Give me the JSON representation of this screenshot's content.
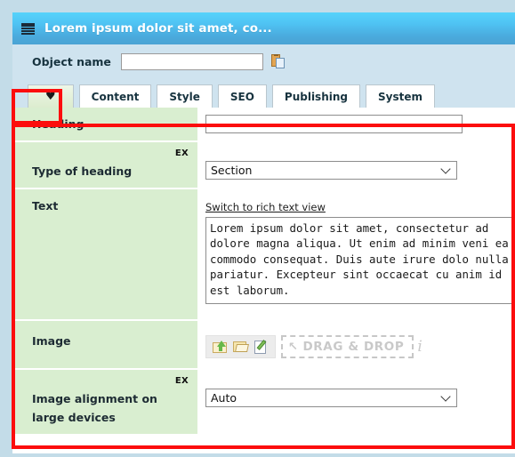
{
  "window": {
    "title": "Lorem ipsum dolor sit amet, co...",
    "menu_icon": "hamburger-icon"
  },
  "object_bar": {
    "label": "Object name",
    "value": "",
    "placeholder": "",
    "copy_icon": "copy-clipboard-icon"
  },
  "tabs": [
    {
      "label": "♥",
      "name": "favorites",
      "active": true
    },
    {
      "label": "Content",
      "name": "content",
      "active": false
    },
    {
      "label": "Style",
      "name": "style",
      "active": false
    },
    {
      "label": "SEO",
      "name": "seo",
      "active": false
    },
    {
      "label": "Publishing",
      "name": "publishing",
      "active": false
    },
    {
      "label": "System",
      "name": "system",
      "active": false
    }
  ],
  "form": {
    "rows": [
      {
        "label": "Heading",
        "badge": "",
        "type": "text",
        "value": "",
        "placeholder": ""
      },
      {
        "label": "Type of heading",
        "badge": "EX",
        "type": "select",
        "value": "Section"
      },
      {
        "label": "Text",
        "badge": "",
        "type": "textarea",
        "switch_link": "Switch to rich text view",
        "value": "Lorem ipsum dolor sit amet, consectetur ad dolore magna aliqua. Ut enim ad minim veni ea commodo consequat. Duis aute irure dolo nulla pariatur. Excepteur sint occaecat cu anim id est laborum."
      },
      {
        "label": "Image",
        "badge": "",
        "type": "image",
        "icons": [
          "upload-folder-icon",
          "open-folder-icon",
          "edit-document-icon"
        ],
        "dropzone_label": "DRAG & DROP",
        "dropzone_cursor": "↖",
        "info_glyph": "i"
      },
      {
        "label": "Image alignment on large devices",
        "badge": "EX",
        "type": "select",
        "value": "Auto"
      }
    ]
  },
  "annotations": {
    "color": "#fc0d0d",
    "boxes": [
      "favorites-tab-highlight",
      "form-area-highlight"
    ]
  }
}
